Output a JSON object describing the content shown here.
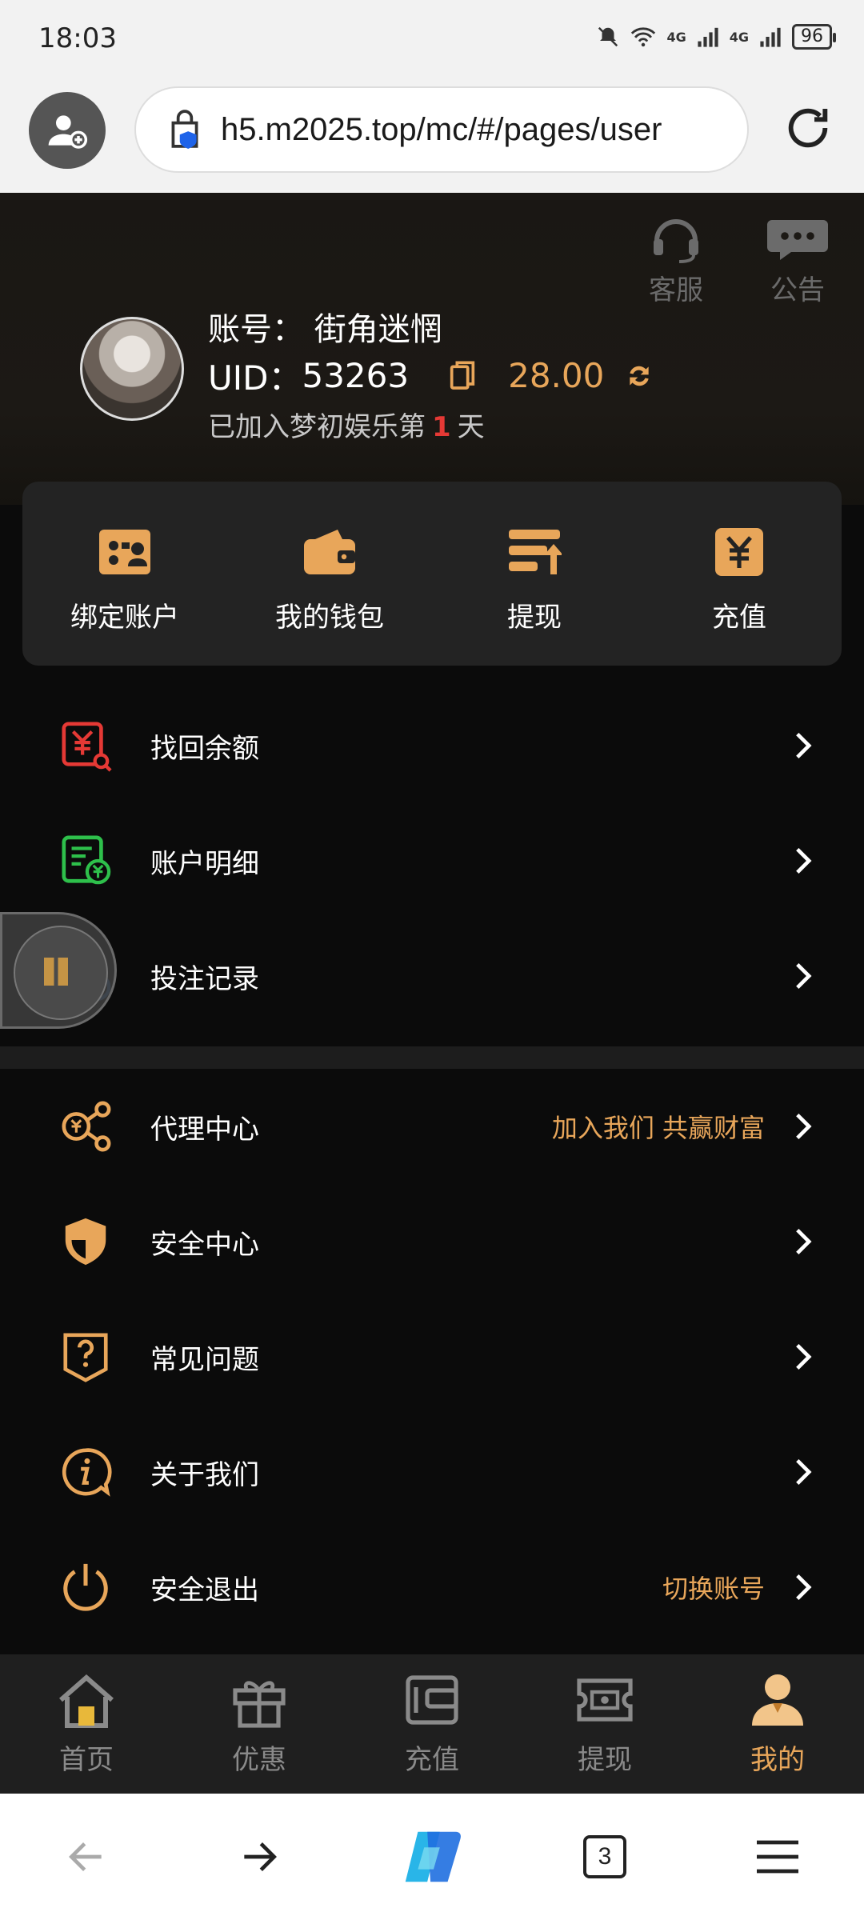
{
  "status_bar": {
    "time": "18:03",
    "battery": "96",
    "net1": "4G",
    "net2": "4G"
  },
  "browser": {
    "url": "h5.m2025.top/mc/#/pages/user",
    "tabs_count": "3"
  },
  "header": {
    "service_label": "客服",
    "notice_label": "公告",
    "account_label": "账号：",
    "account_name": "街角迷惘",
    "uid_label": "UID：",
    "uid": "53263",
    "balance": "28.00",
    "joined_prefix": "已加入梦初娱乐第",
    "joined_days": "1",
    "joined_suffix": "天"
  },
  "quick_actions": [
    {
      "label": "绑定账户",
      "icon": "bind-account-icon"
    },
    {
      "label": "我的钱包",
      "icon": "wallet-icon"
    },
    {
      "label": "提现",
      "icon": "withdraw-icon"
    },
    {
      "label": "充值",
      "icon": "recharge-icon"
    }
  ],
  "menu_group_1": [
    {
      "label": "找回余额",
      "icon": "recover-balance-icon"
    },
    {
      "label": "账户明细",
      "icon": "account-details-icon"
    },
    {
      "label": "投注记录",
      "icon": "bet-records-icon"
    }
  ],
  "menu_group_2": [
    {
      "label": "代理中心",
      "extra": "加入我们 共赢财富",
      "icon": "agent-center-icon"
    },
    {
      "label": "安全中心",
      "extra": "",
      "icon": "shield-icon"
    },
    {
      "label": "常见问题",
      "extra": "",
      "icon": "faq-icon"
    },
    {
      "label": "关于我们",
      "extra": "",
      "icon": "info-icon"
    },
    {
      "label": "安全退出",
      "extra": "切换账号",
      "icon": "power-icon"
    }
  ],
  "tabs": [
    {
      "label": "首页",
      "icon": "home-icon",
      "active": false
    },
    {
      "label": "优惠",
      "icon": "gift-icon",
      "active": false
    },
    {
      "label": "充值",
      "icon": "wallet-tab-icon",
      "active": false
    },
    {
      "label": "提现",
      "icon": "cash-icon",
      "active": false
    },
    {
      "label": "我的",
      "icon": "user-icon",
      "active": true
    }
  ],
  "colors": {
    "accent": "#e8a65a",
    "background": "#0b0b0b",
    "card": "#232323",
    "danger": "#e53935"
  }
}
